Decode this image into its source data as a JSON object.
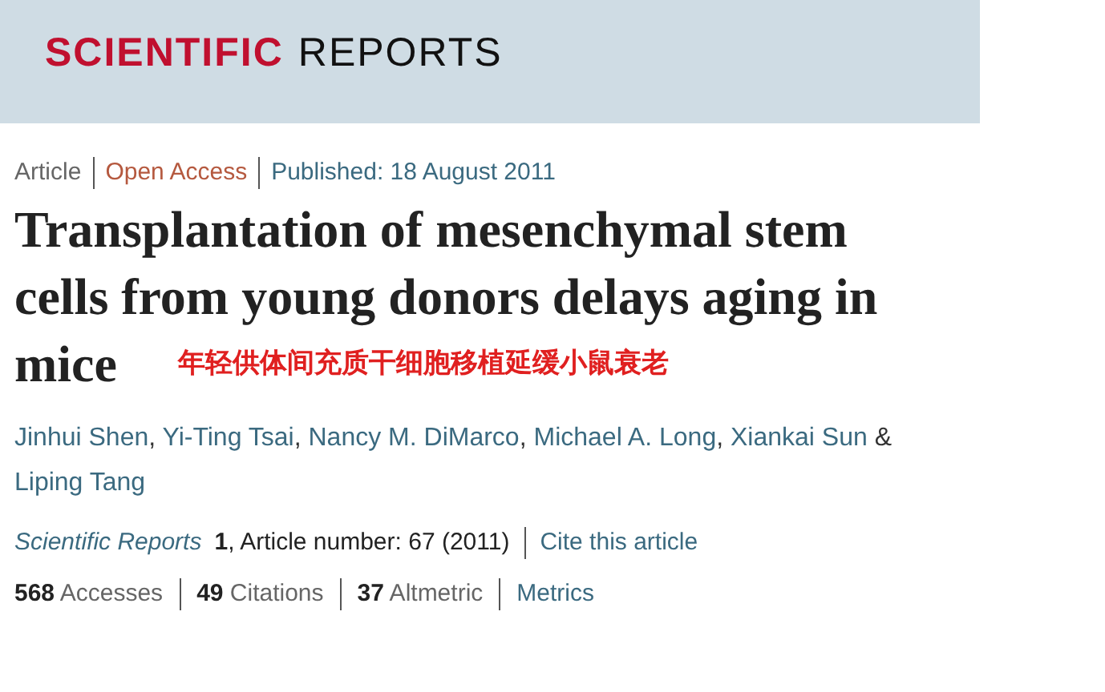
{
  "header": {
    "logo": [
      "SCIENTIFIC",
      "REPORTS"
    ]
  },
  "meta": [
    {
      "kind": "type",
      "text": "Article"
    },
    {
      "kind": "access",
      "text": "Open Access"
    },
    {
      "kind": "date",
      "text": "Published: 18 August 2011"
    }
  ],
  "title_lines": [
    "Transplantation of mesenchymal stem",
    "cells from young donors delays aging in",
    "mice"
  ],
  "title_note": "年轻供体间充质干细胞移植延缓小鼠衰老",
  "authors": [
    {
      "name": "Jinhui Shen",
      "separator": ","
    },
    {
      "name": "Yi-Ting Tsai",
      "separator": ","
    },
    {
      "name": "Nancy M. DiMarco",
      "separator": ","
    },
    {
      "name": "Michael A. Long",
      "separator": ","
    },
    {
      "name": "Xiankai Sun",
      "separator": "&"
    },
    {
      "name": "Liping Tang"
    }
  ],
  "citation": {
    "journal": "Scientific Reports",
    "volume": "1",
    "details": ", Article number: 67 (2011)",
    "cite_link": "Cite this article"
  },
  "metrics": [
    "**568** Accesses",
    "**49** Citations",
    "**37** Altmetric"
  ],
  "metrics_link": "Metrics"
}
